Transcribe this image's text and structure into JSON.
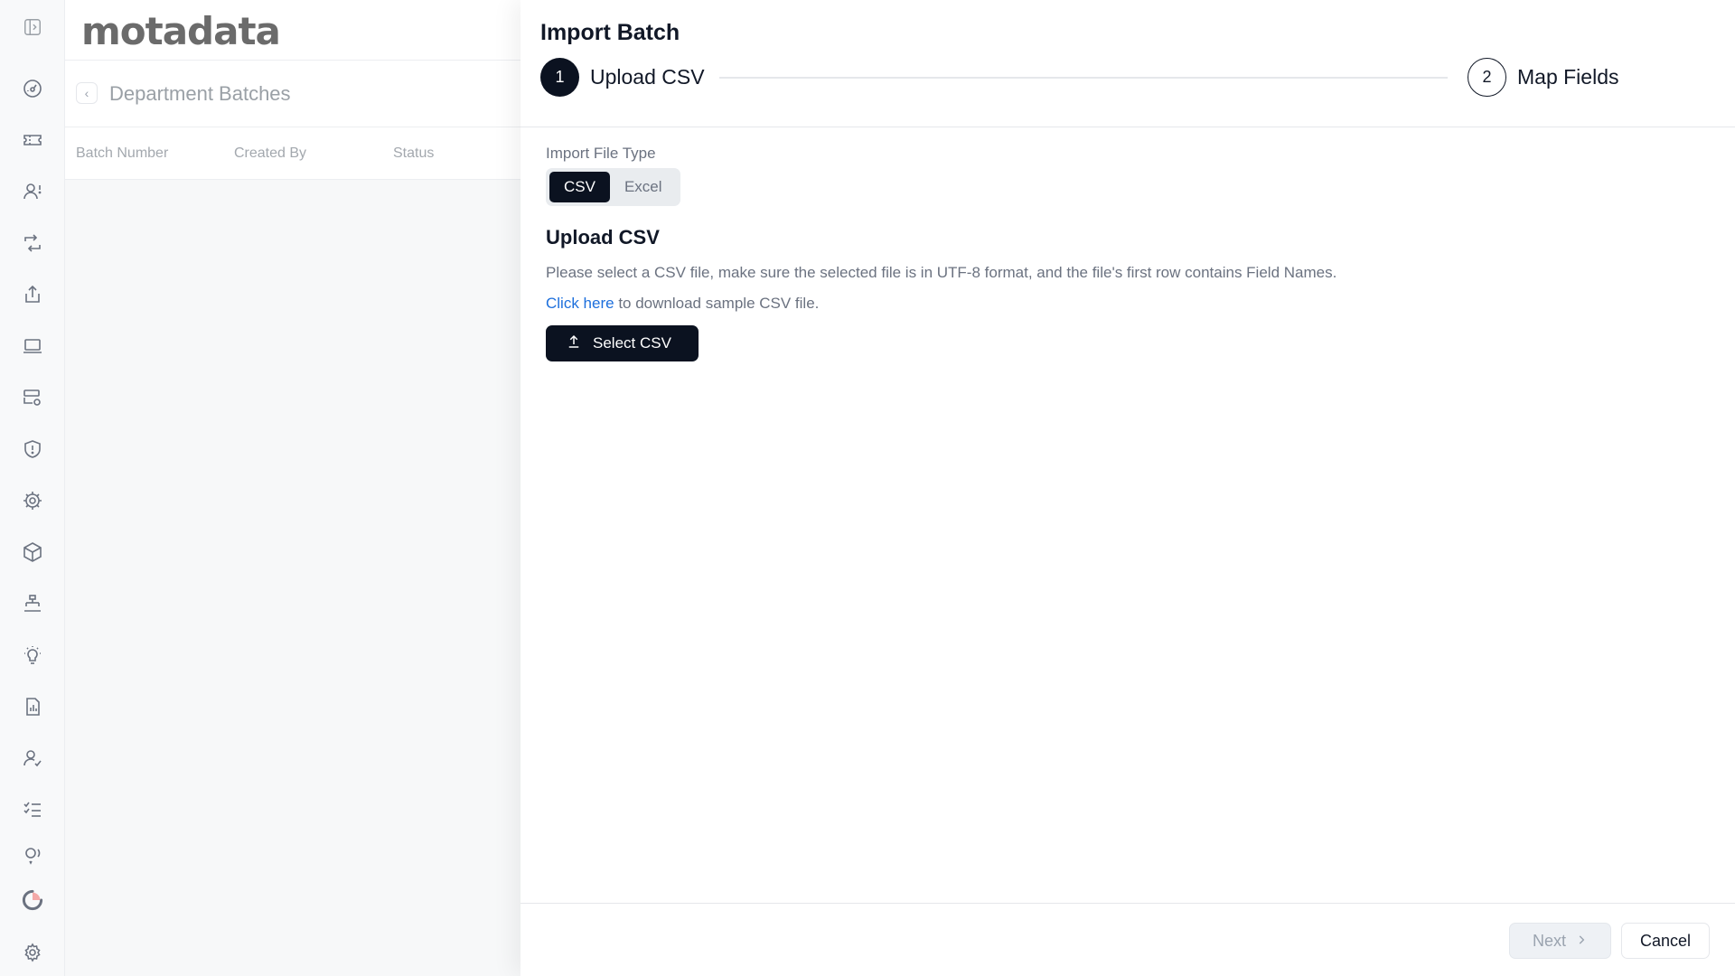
{
  "app": {
    "logo_text": "motadata"
  },
  "rail": {
    "icons": [
      "sidebar-toggle-icon",
      "dashboard-icon",
      "ticket-icon",
      "user-alert-icon",
      "sync-icon",
      "share-icon",
      "laptop-icon",
      "server-settings-icon",
      "shield-alert-icon",
      "gear-cog-icon",
      "box-icon",
      "hierarchy-icon",
      "lightbulb-icon",
      "report-icon",
      "user-check-icon",
      "checklist-icon",
      "user-voice-icon",
      "loader-icon",
      "settings-icon"
    ]
  },
  "background_page": {
    "title": "Department Batches",
    "columns": [
      "Batch Number",
      "Created By",
      "Status"
    ]
  },
  "drawer": {
    "title": "Import Batch",
    "steps": [
      {
        "number": "1",
        "label": "Upload CSV",
        "state": "active"
      },
      {
        "number": "2",
        "label": "Map Fields",
        "state": "inactive"
      }
    ],
    "file_type": {
      "label": "Import File Type",
      "options": [
        "CSV",
        "Excel"
      ],
      "selected": "CSV"
    },
    "upload": {
      "title": "Upload CSV",
      "description": "Please select a CSV file, make sure the selected file is in UTF-8 format, and the file's first row contains Field Names.",
      "link_text": "Click here",
      "hint_suffix": " to download sample CSV file.",
      "button_label": "Select CSV"
    },
    "footer": {
      "next_label": "Next",
      "cancel_label": "Cancel"
    }
  },
  "colors": {
    "primary": "#0b1220",
    "link": "#1d6fdc",
    "muted": "#6b7280"
  }
}
